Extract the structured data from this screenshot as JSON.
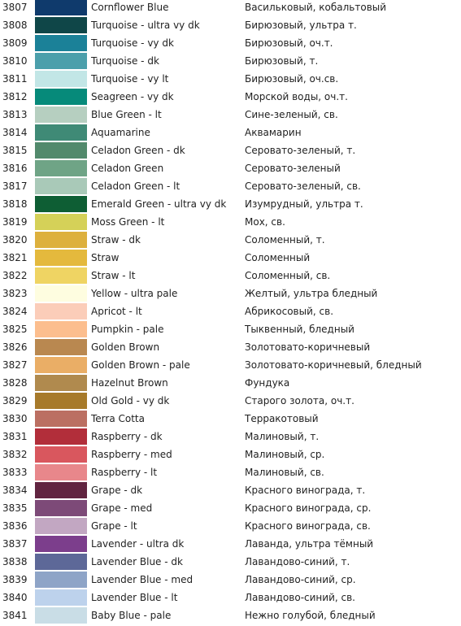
{
  "rows": [
    {
      "code": "3807",
      "color": "#0f3a6c",
      "en": "Cornflower Blue",
      "ru": "Васильковый, кобальтовый"
    },
    {
      "code": "3808",
      "color": "#0f4648",
      "en": "Turquoise - ultra vy dk",
      "ru": "Бирюзовый, ультра т."
    },
    {
      "code": "3809",
      "color": "#1b8198",
      "en": "Turquoise - vy dk",
      "ru": "Бирюзовый, оч.т."
    },
    {
      "code": "3810",
      "color": "#4b9fab",
      "en": "Turquoise - dk",
      "ru": "Бирюзовый, т."
    },
    {
      "code": "3811",
      "color": "#c2e6e6",
      "en": "Turquoise - vy lt",
      "ru": "Бирюзовый, оч.св."
    },
    {
      "code": "3812",
      "color": "#068a7a",
      "en": "Seagreen - vy dk",
      "ru": "Морской воды, оч.т."
    },
    {
      "code": "3813",
      "color": "#b6cfc0",
      "en": "Blue Green - lt",
      "ru": "Сине-зеленый, св."
    },
    {
      "code": "3814",
      "color": "#3f8a76",
      "en": "Aquamarine",
      "ru": "Аквамарин"
    },
    {
      "code": "3815",
      "color": "#528a6c",
      "en": "Celadon Green - dk",
      "ru": "Серовато-зеленый, т."
    },
    {
      "code": "3816",
      "color": "#6fa486",
      "en": "Celadon Green",
      "ru": "Серовато-зеленый"
    },
    {
      "code": "3817",
      "color": "#a9c9b8",
      "en": "Celadon Green - lt",
      "ru": "Серовато-зеленый, св."
    },
    {
      "code": "3818",
      "color": "#0e5e34",
      "en": "Emerald Green - ultra vy dk",
      "ru": "Изумрудный, ультра т."
    },
    {
      "code": "3819",
      "color": "#d5d158",
      "en": "Moss Green - lt",
      "ru": "Мох, св."
    },
    {
      "code": "3820",
      "color": "#ddb03d",
      "en": "Straw - dk",
      "ru": "Соломенный, т."
    },
    {
      "code": "3821",
      "color": "#e4b93d",
      "en": "Straw",
      "ru": "Соломенный"
    },
    {
      "code": "3822",
      "color": "#efd463",
      "en": "Straw - lt",
      "ru": "Соломенный, св."
    },
    {
      "code": "3823",
      "color": "#fefde0",
      "en": "Yellow - ultra pale",
      "ru": "Желтый, ультра бледный"
    },
    {
      "code": "3824",
      "color": "#fbcdb9",
      "en": "Apricot - lt",
      "ru": "Абрикосовый, св."
    },
    {
      "code": "3825",
      "color": "#fcbe8e",
      "en": "Pumpkin - pale",
      "ru": "Тыквенный, бледный"
    },
    {
      "code": "3826",
      "color": "#b98850",
      "en": "Golden Brown",
      "ru": "Золотовато-коричневый"
    },
    {
      "code": "3827",
      "color": "#eaae66",
      "en": "Golden Brown - pale",
      "ru": "Золотовато-коричневый, бледный"
    },
    {
      "code": "3828",
      "color": "#b08a4e",
      "en": "Hazelnut Brown",
      "ru": "Фундука"
    },
    {
      "code": "3829",
      "color": "#a77a2a",
      "en": "Old Gold - vy dk",
      "ru": "Старого золота, оч.т."
    },
    {
      "code": "3830",
      "color": "#bb6f62",
      "en": "Terra Cotta",
      "ru": "Терракотовый"
    },
    {
      "code": "3831",
      "color": "#b22e3a",
      "en": "Raspberry - dk",
      "ru": "Малиновый, т."
    },
    {
      "code": "3832",
      "color": "#d9575e",
      "en": "Raspberry - med",
      "ru": "Малиновый, ср."
    },
    {
      "code": "3833",
      "color": "#e8878b",
      "en": "Raspberry - lt",
      "ru": "Малиновый, св."
    },
    {
      "code": "3834",
      "color": "#612440",
      "en": "Grape - dk",
      "ru": "Красного винограда, т."
    },
    {
      "code": "3835",
      "color": "#7d4a78",
      "en": "Grape - med",
      "ru": "Красного винограда, ср."
    },
    {
      "code": "3836",
      "color": "#c2a7c2",
      "en": "Grape - lt",
      "ru": "Красного винограда, св."
    },
    {
      "code": "3837",
      "color": "#7c3e8c",
      "en": "Lavender - ultra dk",
      "ru": "Лаванда, ультра тёмный"
    },
    {
      "code": "3838",
      "color": "#5d6898",
      "en": "Lavender Blue - dk",
      "ru": "Лавандово-синий, т."
    },
    {
      "code": "3839",
      "color": "#8ea4c7",
      "en": "Lavender Blue - med",
      "ru": "Лавандово-синий, ср."
    },
    {
      "code": "3840",
      "color": "#bdd2ec",
      "en": "Lavender Blue - lt",
      "ru": "Лавандово-синий, св."
    },
    {
      "code": "3841",
      "color": "#c9dde6",
      "en": "Baby Blue - pale",
      "ru": "Нежно голубой, бледный"
    }
  ]
}
